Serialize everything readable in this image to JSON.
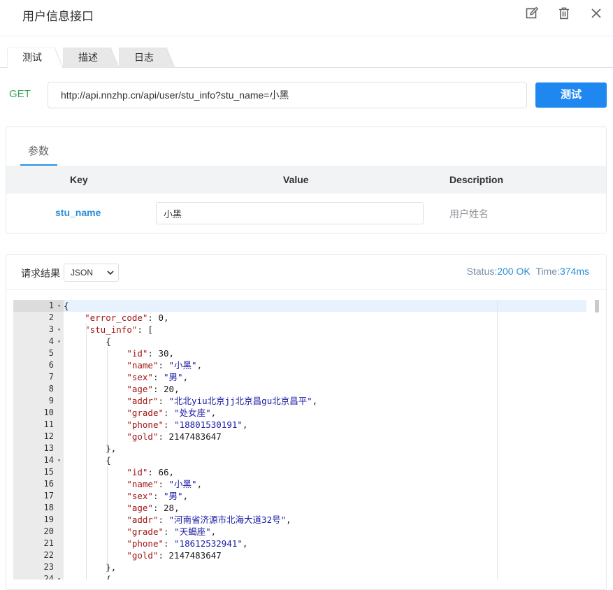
{
  "header": {
    "title": "用户信息接口",
    "icons": [
      "edit-icon",
      "delete-icon",
      "close-icon"
    ]
  },
  "tabs": [
    {
      "label": "测试",
      "active": true
    },
    {
      "label": "描述",
      "active": false
    },
    {
      "label": "日志",
      "active": false
    }
  ],
  "request": {
    "method": "GET",
    "url": "http://api.nnzhp.cn/api/user/stu_info?stu_name=小黑",
    "test_label": "测试"
  },
  "params": {
    "tab_label": "参数",
    "columns": {
      "key": "Key",
      "value": "Value",
      "description": "Description"
    },
    "rows": [
      {
        "key": "stu_name",
        "value": "小黑",
        "description": "用户姓名"
      }
    ]
  },
  "result": {
    "label": "请求结果",
    "format": "JSON",
    "status_label": "Status:",
    "status_value": "200 OK",
    "time_label": "Time:",
    "time_value": "374ms"
  },
  "colors": {
    "accent": "#1e88f0",
    "method": "#3aa55e",
    "link": "#2a8fd6"
  },
  "code_lines": [
    {
      "n": "1",
      "fold": true,
      "text": "{"
    },
    {
      "n": "2",
      "text": "    \"error_code\": 0,"
    },
    {
      "n": "3",
      "fold": true,
      "text": "    \"stu_info\": ["
    },
    {
      "n": "4",
      "fold": true,
      "text": "        {"
    },
    {
      "n": "5",
      "text": "            \"id\": 30,"
    },
    {
      "n": "6",
      "text": "            \"name\": \"小黑\","
    },
    {
      "n": "7",
      "text": "            \"sex\": \"男\","
    },
    {
      "n": "8",
      "text": "            \"age\": 20,"
    },
    {
      "n": "9",
      "text": "            \"addr\": \"北北yiu北京jj北京昌gu北京昌平\","
    },
    {
      "n": "10",
      "text": "            \"grade\": \"处女座\","
    },
    {
      "n": "11",
      "text": "            \"phone\": \"18801530191\","
    },
    {
      "n": "12",
      "text": "            \"gold\": 2147483647"
    },
    {
      "n": "13",
      "text": "        },"
    },
    {
      "n": "14",
      "fold": true,
      "text": "        {"
    },
    {
      "n": "15",
      "text": "            \"id\": 66,"
    },
    {
      "n": "16",
      "text": "            \"name\": \"小黑\","
    },
    {
      "n": "17",
      "text": "            \"sex\": \"男\","
    },
    {
      "n": "18",
      "text": "            \"age\": 28,"
    },
    {
      "n": "19",
      "text": "            \"addr\": \"河南省济源市北海大道32号\","
    },
    {
      "n": "20",
      "text": "            \"grade\": \"天蝎座\","
    },
    {
      "n": "21",
      "text": "            \"phone\": \"18612532941\","
    },
    {
      "n": "22",
      "text": "            \"gold\": 2147483647"
    },
    {
      "n": "23",
      "text": "        },"
    },
    {
      "n": "24",
      "fold": true,
      "text": "        {"
    }
  ]
}
